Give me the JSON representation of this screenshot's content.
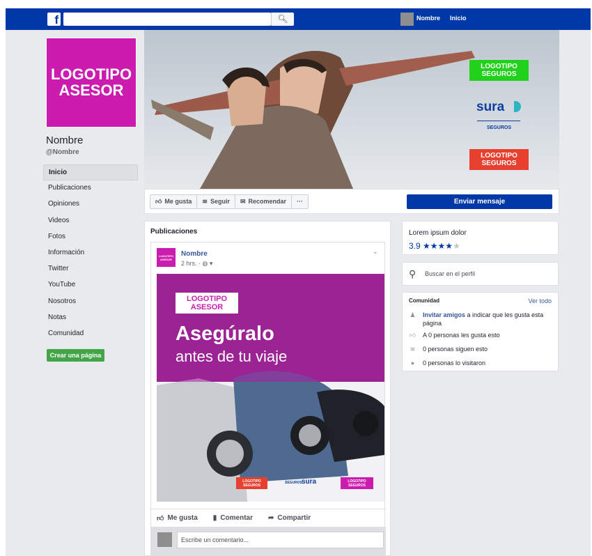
{
  "topbar": {
    "logo": "f",
    "search_icon": "search-icon",
    "name": "Nombre",
    "home": "Inicio"
  },
  "profile": {
    "logo_line1": "LOGOTIPO",
    "logo_line2": "ASESOR",
    "name": "Nombre",
    "handle": "@Nombre"
  },
  "nav": {
    "items": [
      {
        "label": "Inicio",
        "active": true
      },
      {
        "label": "Publicaciones"
      },
      {
        "label": "Opiniones"
      },
      {
        "label": "Videos"
      },
      {
        "label": "Fotos"
      },
      {
        "label": "Información"
      },
      {
        "label": "Twitter"
      },
      {
        "label": "YouTube"
      },
      {
        "label": "Nosotros"
      },
      {
        "label": "Notas"
      },
      {
        "label": "Comunidad"
      }
    ],
    "create_page": "Crear una página"
  },
  "cover": {
    "logo_green_1": "LOGOTIPO",
    "logo_green_2": "SEGUROS",
    "sura": "sura",
    "sura_sub": "SEGUROS",
    "logo_red_1": "LOGOTIPO",
    "logo_red_2": "SEGUROS",
    "colors": {
      "green": "#22d11b",
      "red": "#e8402f",
      "sura_blue": "#0b3ea0"
    }
  },
  "actions": {
    "like": "Me gusta",
    "follow": "Seguir",
    "recommend": "Recomendar",
    "more": "···",
    "send_message": "Enviar mensaje"
  },
  "publications": {
    "title": "Publicaciones",
    "post": {
      "avatar_text": "LOGOTIPO ASESOR",
      "author": "Nombre",
      "time": "2 hrs. · ◍ ▾",
      "image": {
        "logo_1": "LOGOTIPO",
        "logo_2": "ASESOR",
        "headline": "Asegúralo",
        "subheadline": "antes de tu viaje",
        "footer_logo_left_1": "LOGOTIPO",
        "footer_logo_left_2": "SEGUROS",
        "footer_sura_pre": "SEGUROS",
        "footer_sura": "sura",
        "footer_logo_right_1": "LOGOTIPO",
        "footer_logo_right_2": "SEGUROS"
      },
      "like": "Me gusta",
      "comment": "Comentar",
      "share": "Compartir",
      "comment_placeholder": "Escribe un comentario..."
    }
  },
  "rating_box": {
    "title": "Lorem ipsum dolor",
    "score": "3.9",
    "stars_filled": 4,
    "stars_total": 5
  },
  "profile_search": {
    "placeholder": "Buscar en el perfil"
  },
  "community": {
    "title": "Comunidad",
    "see_all": "Ver todo",
    "invite_link": "Invitar amigos",
    "invite_rest": "a indicar que les gusta esta página",
    "likes": "A 0 personas les gusta esto",
    "follows": "0 personas siguen esto",
    "visits": "0 personas lo visitaron"
  }
}
